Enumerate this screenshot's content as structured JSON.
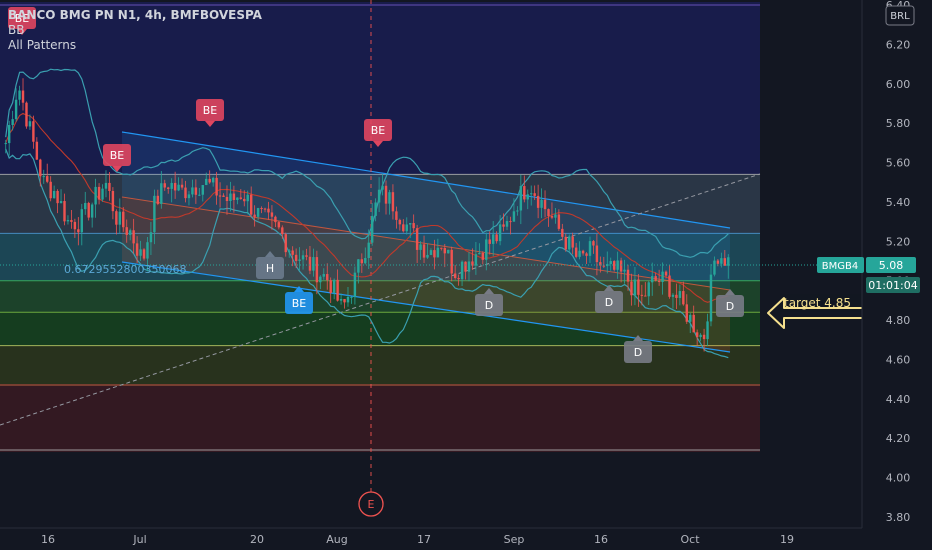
{
  "header": {
    "title": "BANCO BMG PN N1, 4h, BMFBOVESPA",
    "indicator_bb": "BB",
    "indicator_patterns": "All Patterns"
  },
  "currency_label": "BRL",
  "price_axis": {
    "ticks": [
      "6.40",
      "6.20",
      "6.00",
      "5.80",
      "5.60",
      "5.40",
      "5.20",
      "5.00",
      "4.80",
      "4.60",
      "4.40",
      "4.20",
      "4.00",
      "3.80"
    ],
    "ticker_label": "BMGB4",
    "last_price": "5.08",
    "countdown": "01:01:04"
  },
  "time_axis": {
    "ticks": [
      "16",
      "Jul",
      "20",
      "Aug",
      "17",
      "Sep",
      "16",
      "Oct",
      "19"
    ]
  },
  "fib_label": "0.6729552800350068",
  "pattern_labels": [
    {
      "text": "BE",
      "kind": "bearish"
    },
    {
      "text": "BE",
      "kind": "bearish"
    },
    {
      "text": "BE",
      "kind": "bearish"
    },
    {
      "text": "BE",
      "kind": "bearish"
    },
    {
      "text": "H",
      "kind": "neutral"
    },
    {
      "text": "BE",
      "kind": "bullish"
    },
    {
      "text": "D",
      "kind": "doji"
    },
    {
      "text": "D",
      "kind": "doji"
    },
    {
      "text": "D",
      "kind": "doji"
    },
    {
      "text": "D",
      "kind": "doji"
    }
  ],
  "event_marker": "E",
  "annotation": {
    "text": "target 4.85"
  },
  "colors": {
    "background": "#131722",
    "up_candle": "#26a69a",
    "down_candle": "#ef5350",
    "bearish_label": "#e0465f",
    "bullish_label": "#2196f3",
    "doji_label": "#787b86",
    "annotation": "#f5e08e",
    "channel": "#2196f3"
  },
  "chart_data": {
    "type": "candlestick",
    "symbol": "BANCO BMG PN N1",
    "interval": "4h",
    "exchange": "BMFBOVESPA",
    "ylim": [
      3.8,
      6.4
    ],
    "last_price": 5.08,
    "horizontal_levels": [
      6.4,
      5.54,
      5.24,
      5.08,
      5.0,
      4.84,
      4.67,
      4.47,
      4.14
    ],
    "channel": {
      "upper_start": 5.75,
      "upper_end": 5.27,
      "lower_start": 5.01,
      "lower_end": 4.63
    },
    "target": 4.85,
    "close_path": [
      5.7,
      6.0,
      5.75,
      5.5,
      5.45,
      5.3,
      5.3,
      5.4,
      5.5,
      5.3,
      5.25,
      5.1,
      5.4,
      5.5,
      5.45,
      5.48,
      5.5,
      5.45,
      5.4,
      5.45,
      5.35,
      5.3,
      5.25,
      5.15,
      5.1,
      5.05,
      5.0,
      4.85,
      5.0,
      5.2,
      5.45,
      5.4,
      5.3,
      5.2,
      5.15,
      5.2,
      5.05,
      5.1,
      5.15,
      5.2,
      5.25,
      5.4,
      5.5,
      5.4,
      5.3,
      5.2,
      5.1,
      5.15,
      5.05,
      5.05,
      5.0,
      4.9,
      5.0,
      5.0,
      4.9,
      4.8,
      4.7,
      5.15,
      5.1
    ]
  }
}
